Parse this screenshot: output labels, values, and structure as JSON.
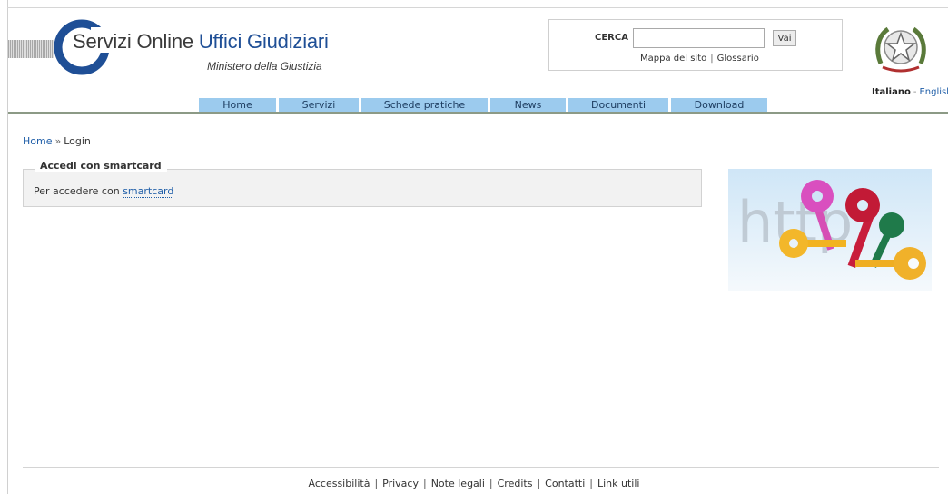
{
  "header": {
    "title_part1": "Servizi Online",
    "title_part2": "Uffici Giudiziari",
    "subtitle": "Ministero della Giustizia"
  },
  "search": {
    "label": "CERCA",
    "value": "",
    "placeholder": "",
    "button_label": "Vai",
    "links": [
      "Mappa del sito",
      "Glossario"
    ],
    "separator": "|"
  },
  "language": {
    "current": "Italiano",
    "separator": "-",
    "other": "English"
  },
  "nav": {
    "items": [
      {
        "label": "Home"
      },
      {
        "label": "Servizi"
      },
      {
        "label": "Schede pratiche"
      },
      {
        "label": "News"
      },
      {
        "label": "Documenti"
      },
      {
        "label": "Download"
      }
    ]
  },
  "breadcrumb": {
    "home": "Home",
    "separator": "»",
    "current": "Login"
  },
  "panel": {
    "title": "Accedi con smartcard",
    "text": "Per accedere con",
    "link": "smartcard"
  },
  "footer": {
    "links": [
      "Accessibilità",
      "Privacy",
      "Note legali",
      "Credits",
      "Contatti",
      "Link utili"
    ],
    "separator": "|"
  },
  "colors": {
    "nav_bg": "#9ccbee",
    "link": "#1f5ea8",
    "brand_blue": "#1f4f96",
    "panel_bg": "#f2f2f2"
  },
  "icons": {
    "logo": "servizi-online-c-logo",
    "emblem": "italian-republic-emblem",
    "illustration": "colored-keys-image"
  }
}
